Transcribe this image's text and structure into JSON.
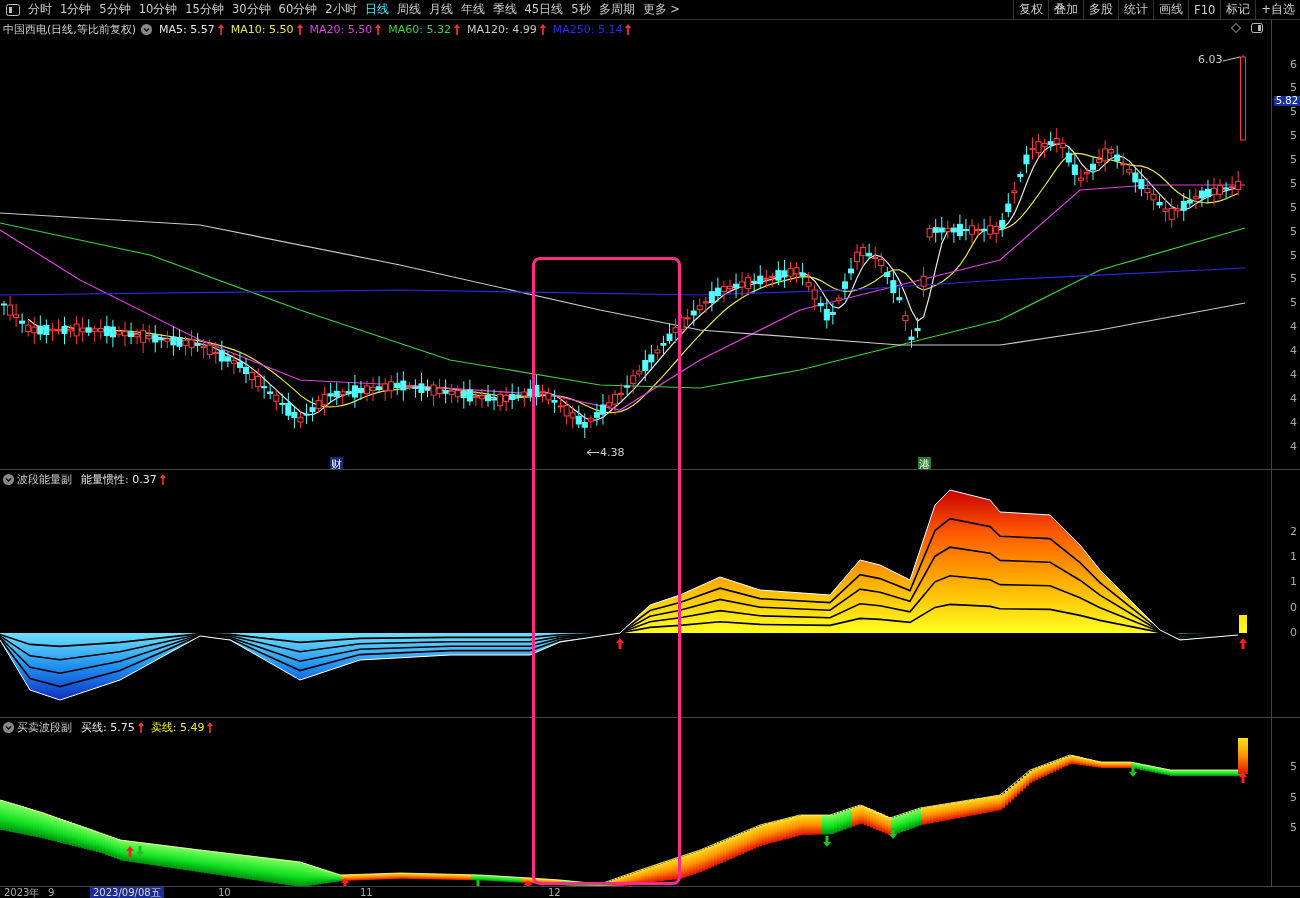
{
  "toolbar": {
    "tabs": [
      {
        "label": "分时",
        "selected": false
      },
      {
        "label": "1分钟",
        "selected": false
      },
      {
        "label": "5分钟",
        "selected": false
      },
      {
        "label": "10分钟",
        "selected": false
      },
      {
        "label": "15分钟",
        "selected": false
      },
      {
        "label": "30分钟",
        "selected": false
      },
      {
        "label": "60分钟",
        "selected": false
      },
      {
        "label": "2小时",
        "selected": false
      },
      {
        "label": "日线",
        "selected": true
      },
      {
        "label": "周线",
        "selected": false
      },
      {
        "label": "月线",
        "selected": false
      },
      {
        "label": "年线",
        "selected": false
      },
      {
        "label": "季线",
        "selected": false
      },
      {
        "label": "45日线",
        "selected": false
      },
      {
        "label": "5秒",
        "selected": false
      },
      {
        "label": "多周期",
        "selected": false
      },
      {
        "label": "更多 >",
        "selected": false
      }
    ],
    "buttons": [
      "复权",
      "叠加",
      "多股",
      "统计",
      "画线",
      "F10",
      "标记",
      "+自选"
    ]
  },
  "main_panel": {
    "title": "中国西电(日线,等比前复权)",
    "legend": [
      {
        "label": "MA5: 5.57",
        "color": "#e6e6e6"
      },
      {
        "label": "MA10: 5.50",
        "color": "#e8e84a"
      },
      {
        "label": "MA20: 5.50",
        "color": "#e040e0"
      },
      {
        "label": "MA60: 5.32",
        "color": "#40d040"
      },
      {
        "label": "MA120: 4.99",
        "color": "#c8c8c8"
      },
      {
        "label": "MA250: 5.14",
        "color": "#2a2ae8"
      }
    ],
    "high_label": "6.03",
    "low_label": "4.38",
    "last_price": "5.82",
    "event_markers": [
      {
        "label": "财",
        "kind": "finance"
      },
      {
        "label": "港",
        "kind": "hk"
      }
    ],
    "axis_labels": [
      "6",
      "5",
      "5",
      "5",
      "5",
      "5",
      "5",
      "5",
      "5",
      "5",
      "5",
      "4",
      "4",
      "4",
      "4",
      "4",
      "4"
    ]
  },
  "energy_panel": {
    "title": "波段能量副",
    "indicator": "能量惯性: 0.37",
    "axis_labels": [
      "2",
      "1",
      "1",
      "0",
      "0"
    ]
  },
  "wave_panel": {
    "title": "买卖波段副",
    "buy_line": "买线: 5.75",
    "sell_line": "卖线: 5.49",
    "axis_labels": [
      "5",
      "5",
      "5"
    ]
  },
  "date_axis": {
    "labels": [
      "2023年",
      "9",
      "10",
      "11",
      "12"
    ],
    "cursor_date": "2023/09/08五"
  }
}
